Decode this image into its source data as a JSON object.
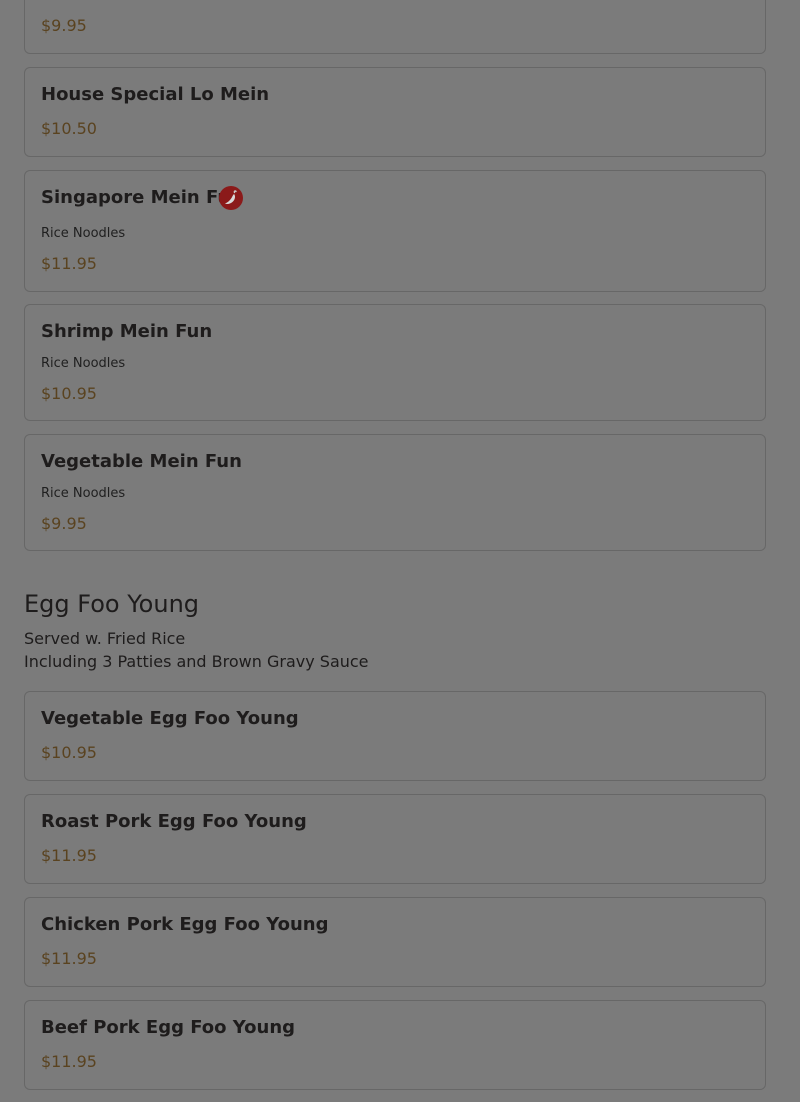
{
  "noodles": {
    "items": [
      {
        "price": "$9.95"
      },
      {
        "name": "House Special Lo Mein",
        "price": "$10.50"
      },
      {
        "name": "Singapore Mein Fun",
        "desc": "Rice Noodles",
        "price": "$11.95",
        "icon": "spicy-pepper-icon"
      },
      {
        "name": "Shrimp Mein Fun",
        "desc": "Rice Noodles",
        "price": "$10.95"
      },
      {
        "name": "Vegetable Mein Fun",
        "desc": "Rice Noodles",
        "price": "$9.95"
      }
    ]
  },
  "egg_foo_young": {
    "title": "Egg Foo Young",
    "note_line1": "Served w. Fried Rice",
    "note_line2": "Including 3 Patties and Brown Gravy Sauce",
    "items": [
      {
        "name": "Vegetable Egg Foo Young",
        "price": "$10.95"
      },
      {
        "name": "Roast Pork Egg Foo Young",
        "price": "$11.95"
      },
      {
        "name": "Chicken Pork Egg Foo Young",
        "price": "$11.95"
      },
      {
        "name": "Beef Pork Egg Foo Young",
        "price": "$11.95"
      }
    ]
  },
  "colors": {
    "overlay_background": "#7b7b7b",
    "card_border": "#676767",
    "price_text": "#5a4320",
    "spicy_icon": "#8b1a1a"
  }
}
